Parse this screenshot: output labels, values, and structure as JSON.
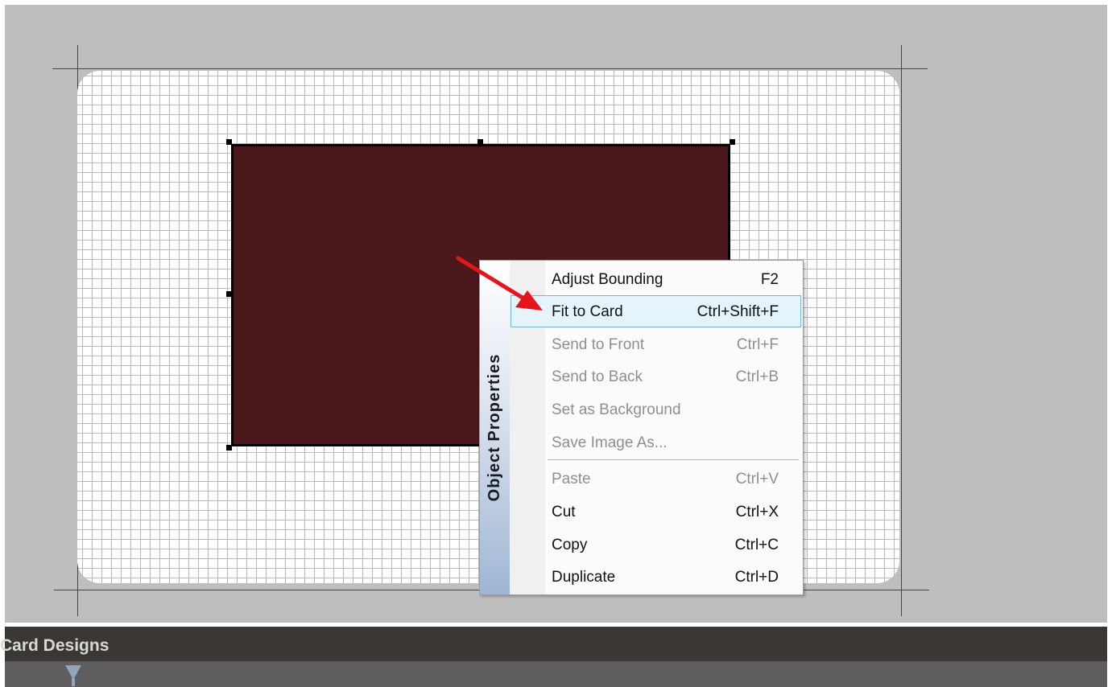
{
  "context_menu": {
    "title": "Object Properties",
    "items": [
      {
        "label": "Adjust Bounding",
        "shortcut": "F2",
        "enabled": true
      },
      {
        "label": "Fit to Card",
        "shortcut": "Ctrl+Shift+F",
        "enabled": true,
        "highlighted": true
      },
      {
        "label": "Send to Front",
        "shortcut": "Ctrl+F",
        "enabled": false
      },
      {
        "label": "Send to Back",
        "shortcut": "Ctrl+B",
        "enabled": false
      },
      {
        "label": "Set as Background",
        "shortcut": "",
        "enabled": false
      },
      {
        "label": "Save Image As...",
        "shortcut": "",
        "enabled": false
      },
      {
        "label": "Paste",
        "shortcut": "Ctrl+V",
        "enabled": false
      },
      {
        "label": "Cut",
        "shortcut": "Ctrl+X",
        "enabled": true
      },
      {
        "label": "Copy",
        "shortcut": "Ctrl+C",
        "enabled": true
      },
      {
        "label": "Duplicate",
        "shortcut": "Ctrl+D",
        "enabled": true
      }
    ]
  },
  "panel": {
    "title": "Card Designs"
  },
  "canvas": {
    "shape_fill": "#4a181a",
    "arrow_color": "#e8141b"
  }
}
